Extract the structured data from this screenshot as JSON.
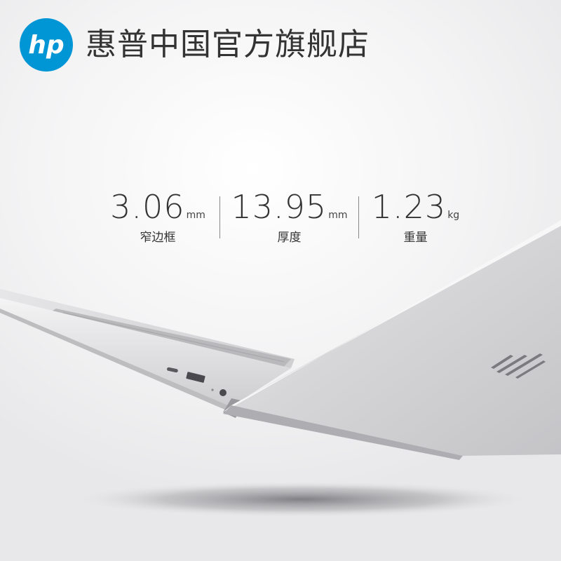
{
  "header": {
    "store_name": "惠普中国官方旗舰店",
    "logo_text": "hp",
    "brand_color": "#0096d6"
  },
  "specs": [
    {
      "value": "3.06",
      "unit": "mm",
      "label": "窄边框"
    },
    {
      "value": "13.95",
      "unit": "mm",
      "label": "厚度"
    },
    {
      "value": "1.23",
      "unit": "kg",
      "label": "重量"
    }
  ],
  "product": {
    "image": "silver-laptop-side-view",
    "color": "#d9dadc"
  }
}
